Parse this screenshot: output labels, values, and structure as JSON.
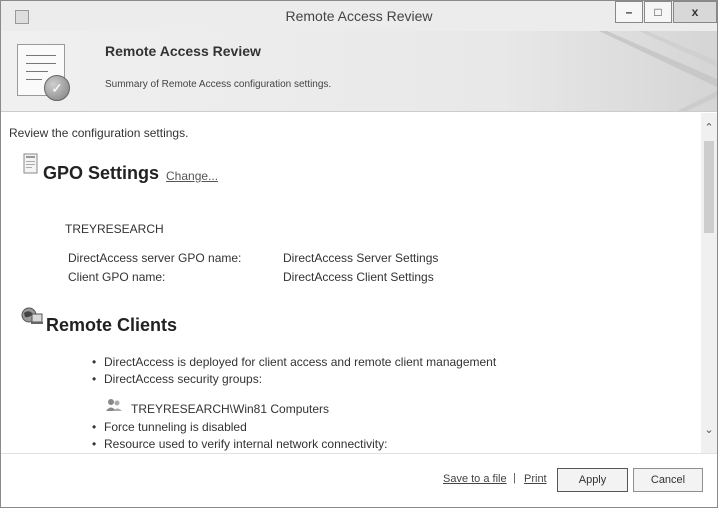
{
  "window": {
    "title": "Remote Access Review",
    "icons": [
      "app-icon",
      "minimize-icon",
      "maximize-icon",
      "close-icon"
    ]
  },
  "header": {
    "title": "Remote Access Review",
    "subtitle": "Summary of Remote Access configuration settings."
  },
  "intro": "Review the configuration settings.",
  "gpo": {
    "title": "GPO Settings",
    "change": "Change...",
    "domain": "TREYRESEARCH",
    "rows": [
      {
        "label": "DirectAccess server GPO name:",
        "value": "DirectAccess Server Settings"
      },
      {
        "label": "Client GPO name:",
        "value": "DirectAccess Client Settings"
      }
    ]
  },
  "clients": {
    "title": "Remote Clients",
    "items": [
      "DirectAccess is deployed for client access and remote client management",
      "DirectAccess security groups:"
    ],
    "group": "TREYRESEARCH\\Win81 Computers",
    "items2": [
      "Force tunneling is disabled",
      "Resource used to verify internal network connectivity:"
    ]
  },
  "footer": {
    "save": "Save to a file",
    "separator": "|",
    "print": "Print",
    "apply": "Apply",
    "cancel": "Cancel"
  }
}
